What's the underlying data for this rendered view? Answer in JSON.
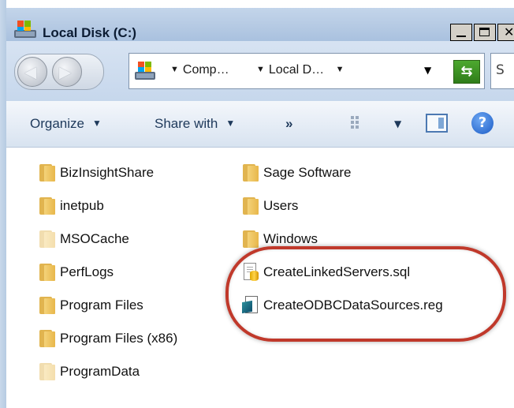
{
  "window": {
    "title": "Local Disk (C:)"
  },
  "address": {
    "crumbs": [
      "Comp…",
      "Local D…"
    ],
    "search_partial": "S"
  },
  "toolbar": {
    "organize_label": "Organize",
    "share_label": "Share with",
    "more_label": "»"
  },
  "files": {
    "left_column": [
      {
        "label": "BizInsightShare",
        "icon": "folder-icon"
      },
      {
        "label": "inetpub",
        "icon": "folder-icon"
      },
      {
        "label": "MSOCache",
        "icon": "folder-icon",
        "hidden": true
      },
      {
        "label": "PerfLogs",
        "icon": "folder-icon"
      },
      {
        "label": "Program Files",
        "icon": "folder-icon"
      },
      {
        "label": "Program Files (x86)",
        "icon": "folder-icon"
      },
      {
        "label": "ProgramData",
        "icon": "folder-icon",
        "hidden": true
      }
    ],
    "right_column": [
      {
        "label": "Sage Software",
        "icon": "folder-icon"
      },
      {
        "label": "Users",
        "icon": "folder-icon"
      },
      {
        "label": "Windows",
        "icon": "folder-icon"
      },
      {
        "label": "CreateLinkedServers.sql",
        "icon": "sql-file-icon"
      },
      {
        "label": "CreateODBCDataSources.reg",
        "icon": "registry-file-icon"
      }
    ]
  },
  "colors": {
    "highlight": "#c0392b",
    "titlebar": "#b7cbe4",
    "toolbar_text": "#1e395b"
  }
}
